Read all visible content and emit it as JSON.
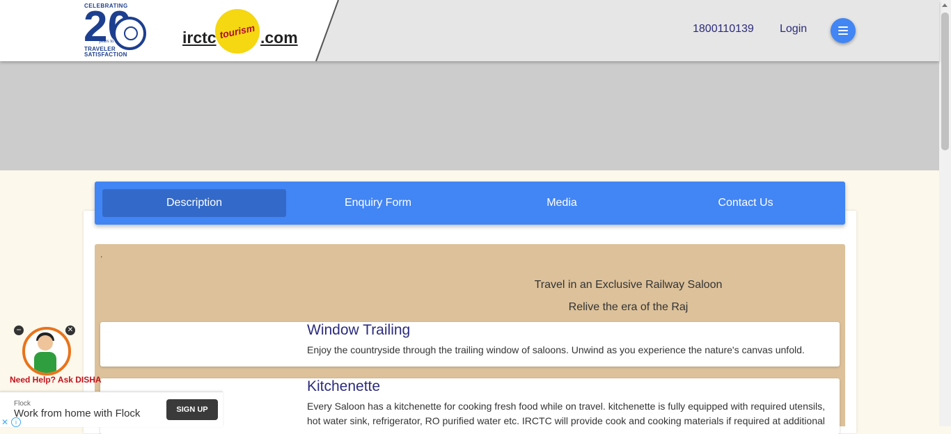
{
  "header": {
    "logo20": {
      "top": "CELEBRATING",
      "numeral": "20",
      "middle": "years to",
      "bottom_1": "TRAVELER",
      "bottom_2": "SATISFACTION"
    },
    "brand": {
      "left": "irctc",
      "badge": "tourism",
      "right": ".com"
    },
    "phone": "1800110139",
    "login_label": "Login",
    "menu_icon": "hamburger-icon"
  },
  "tabs": [
    {
      "label": "Description",
      "active": true
    },
    {
      "label": "Enquiry Form",
      "active": false
    },
    {
      "label": "Media",
      "active": false
    },
    {
      "label": "Contact Us",
      "active": false
    }
  ],
  "description": {
    "dot": ".",
    "tagline_1": "Travel in an Exclusive Railway Saloon",
    "tagline_2": "Relive the era of the Raj",
    "features": [
      {
        "title": "Window Trailing",
        "text": "Enjoy the countryside through the trailing window of saloons. Unwind as you experience the nature's canvas unfold."
      },
      {
        "title": "Kitchenette",
        "text": "Every Saloon has a kitchenette for cooking fresh food while on travel. kitchenette is fully equipped with required utensils, hot water sink, refrigerator, RO purified water etc. IRCTC will provide cook and cooking materials if required at additional"
      }
    ]
  },
  "disha": {
    "label": "Need Help? Ask DISHA"
  },
  "ad": {
    "brand": "Flock",
    "headline": "Work from home with Flock",
    "cta": "SIGN UP"
  },
  "colors": {
    "primary": "#4285f4",
    "active_tab": "#336ac9",
    "description_bg": "#dcc19a",
    "heading": "#2b2b7d",
    "page_bg": "#fdf8ec",
    "banner": "#cccccc"
  }
}
